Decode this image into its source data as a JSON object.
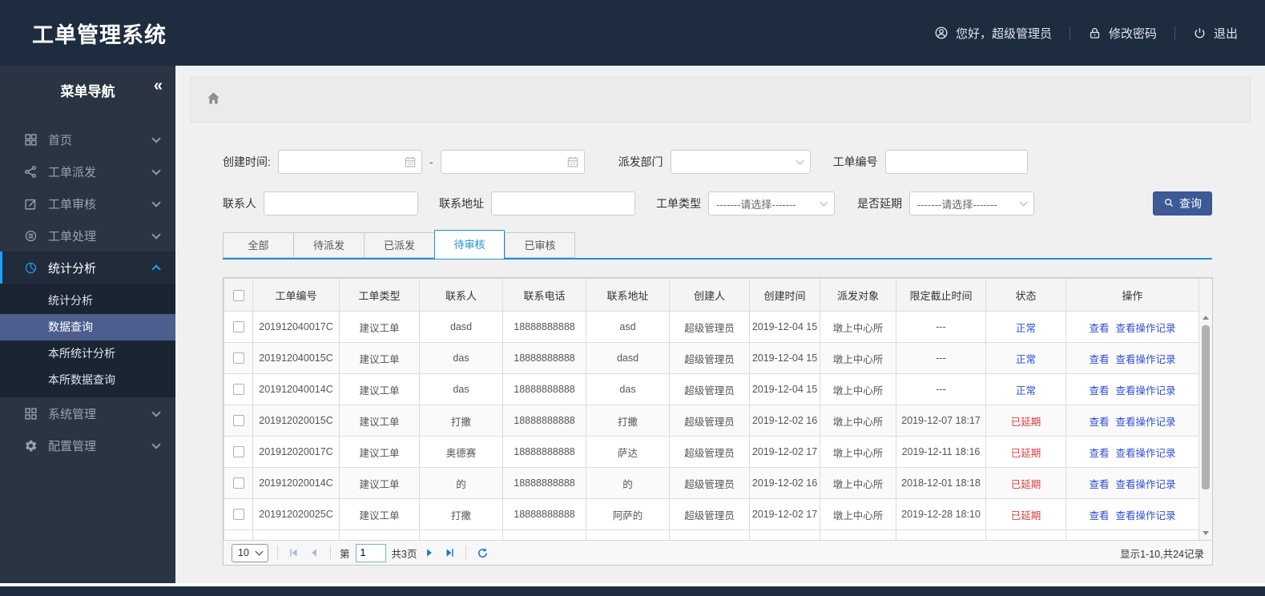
{
  "app": {
    "title": "工单管理系统"
  },
  "topbar": {
    "greeting": "您好，超级管理员",
    "change_password": "修改密码",
    "logout": "退出"
  },
  "sidebar": {
    "title": "菜单导航",
    "collapse_icon": "«",
    "items": [
      {
        "label": "首页"
      },
      {
        "label": "工单派发"
      },
      {
        "label": "工单审核"
      },
      {
        "label": "工单处理"
      },
      {
        "label": "统计分析",
        "active": true,
        "expanded": true
      },
      {
        "label": "系统管理"
      },
      {
        "label": "配置管理"
      }
    ],
    "submenu": [
      {
        "label": "统计分析"
      },
      {
        "label": "数据查询",
        "selected": true
      },
      {
        "label": "本所统计分析"
      },
      {
        "label": "本所数据查询"
      }
    ]
  },
  "filters": {
    "create_time_label": "创建时间:",
    "range_separator": "-",
    "dispatch_dept_label": "派发部门",
    "order_no_label": "工单编号",
    "contact_label": "联系人",
    "address_label": "联系地址",
    "order_type_label": "工单类型",
    "delay_label": "是否延期",
    "select_placeholder": "-------请选择-------",
    "search_button": "查询"
  },
  "tabs": [
    {
      "label": "全部"
    },
    {
      "label": "待派发"
    },
    {
      "label": "已派发"
    },
    {
      "label": "待审核",
      "active": true
    },
    {
      "label": "已审核"
    }
  ],
  "table": {
    "headers": [
      "工单编号",
      "工单类型",
      "联系人",
      "联系电话",
      "联系地址",
      "创建人",
      "创建时间",
      "派发对象",
      "限定截止时间",
      "状态",
      "操作"
    ],
    "actions": {
      "view": "查看",
      "view_log": "查看操作记录"
    },
    "rows": [
      {
        "order_no": "201912040017C",
        "type": "建议工单",
        "contact": "dasd",
        "phone": "18888888888",
        "address": "asd",
        "creator": "超级管理员",
        "created": "2019-12-04 15",
        "target": "墩上中心所",
        "deadline": "---",
        "status": "正常",
        "status_type": "normal"
      },
      {
        "order_no": "201912040015C",
        "type": "建议工单",
        "contact": "das",
        "phone": "18888888888",
        "address": "dasd",
        "creator": "超级管理员",
        "created": "2019-12-04 15",
        "target": "墩上中心所",
        "deadline": "---",
        "status": "正常",
        "status_type": "normal"
      },
      {
        "order_no": "201912040014C",
        "type": "建议工单",
        "contact": "das",
        "phone": "18888888888",
        "address": "das",
        "creator": "超级管理员",
        "created": "2019-12-04 15",
        "target": "墩上中心所",
        "deadline": "---",
        "status": "正常",
        "status_type": "normal"
      },
      {
        "order_no": "201912020015C",
        "type": "建议工单",
        "contact": "打撒",
        "phone": "18888888888",
        "address": "打撒",
        "creator": "超级管理员",
        "created": "2019-12-02 16",
        "target": "墩上中心所",
        "deadline": "2019-12-07 18:17",
        "status": "已延期",
        "status_type": "delayed"
      },
      {
        "order_no": "201912020017C",
        "type": "建议工单",
        "contact": "奥德赛",
        "phone": "18888888888",
        "address": "萨达",
        "creator": "超级管理员",
        "created": "2019-12-02 17",
        "target": "墩上中心所",
        "deadline": "2019-12-11 18:16",
        "status": "已延期",
        "status_type": "delayed"
      },
      {
        "order_no": "201912020014C",
        "type": "建议工单",
        "contact": "的",
        "phone": "18888888888",
        "address": "的",
        "creator": "超级管理员",
        "created": "2019-12-02 16",
        "target": "墩上中心所",
        "deadline": "2018-12-01 18:18",
        "status": "已延期",
        "status_type": "delayed"
      },
      {
        "order_no": "201912020025C",
        "type": "建议工单",
        "contact": "打撒",
        "phone": "18888888888",
        "address": "阿萨的",
        "creator": "超级管理员",
        "created": "2019-12-02 17",
        "target": "墩上中心所",
        "deadline": "2019-12-28 18:10",
        "status": "已延期",
        "status_type": "delayed"
      }
    ]
  },
  "pagination": {
    "page_size": "10",
    "page_prefix": "第",
    "current_page": "1",
    "total_pages": "共3页",
    "summary": "显示1-10,共24记录"
  },
  "icons": {
    "user": "circle-person",
    "lock": "padlock",
    "power": "power-symbol",
    "home": "house",
    "calendar": "calendar-grid",
    "search": "magnifier",
    "collapse": "«",
    "chevron_down": "v",
    "chevron_up": "^",
    "refresh": "circular-arrow",
    "first_page": "bar-left-triangle",
    "prev_page": "left-triangle",
    "next_page": "right-triangle",
    "last_page": "right-triangle-bar"
  },
  "colors": {
    "topbar_bg": "#1e2c40",
    "sidebar_bg": "#2a3442",
    "submenu_selected_bg": "#4c5e8e",
    "accent_blue": "#1a93d6",
    "sidebar_active_blue": "#1e9fff",
    "link_blue": "#2f4fd8",
    "status_normal": "#2f4fd8",
    "status_delayed": "#e23b3b",
    "search_button_bg": "#3d5a96",
    "pager_icon_blue": "#1878c8",
    "pager_icon_disabled": "#a3bed6"
  }
}
